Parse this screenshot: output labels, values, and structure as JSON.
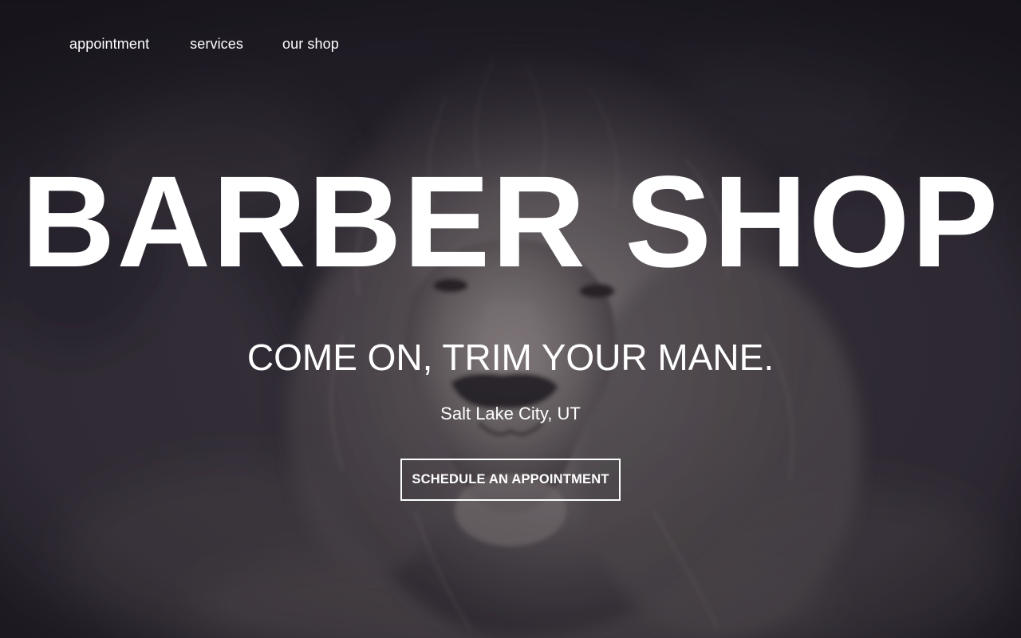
{
  "nav": {
    "items": [
      {
        "label": "appointment"
      },
      {
        "label": "services"
      },
      {
        "label": "our shop"
      }
    ]
  },
  "hero": {
    "title": "BARBER SHOP",
    "tagline": "COME ON, TRIM YOUR MANE.",
    "location": "Salt Lake City, UT",
    "cta_label": "SCHEDULE AN APPOINTMENT",
    "background_image": "lion-photo"
  },
  "colors": {
    "background": "#221f27",
    "text": "#ffffff",
    "cta_border": "#ffffff"
  }
}
